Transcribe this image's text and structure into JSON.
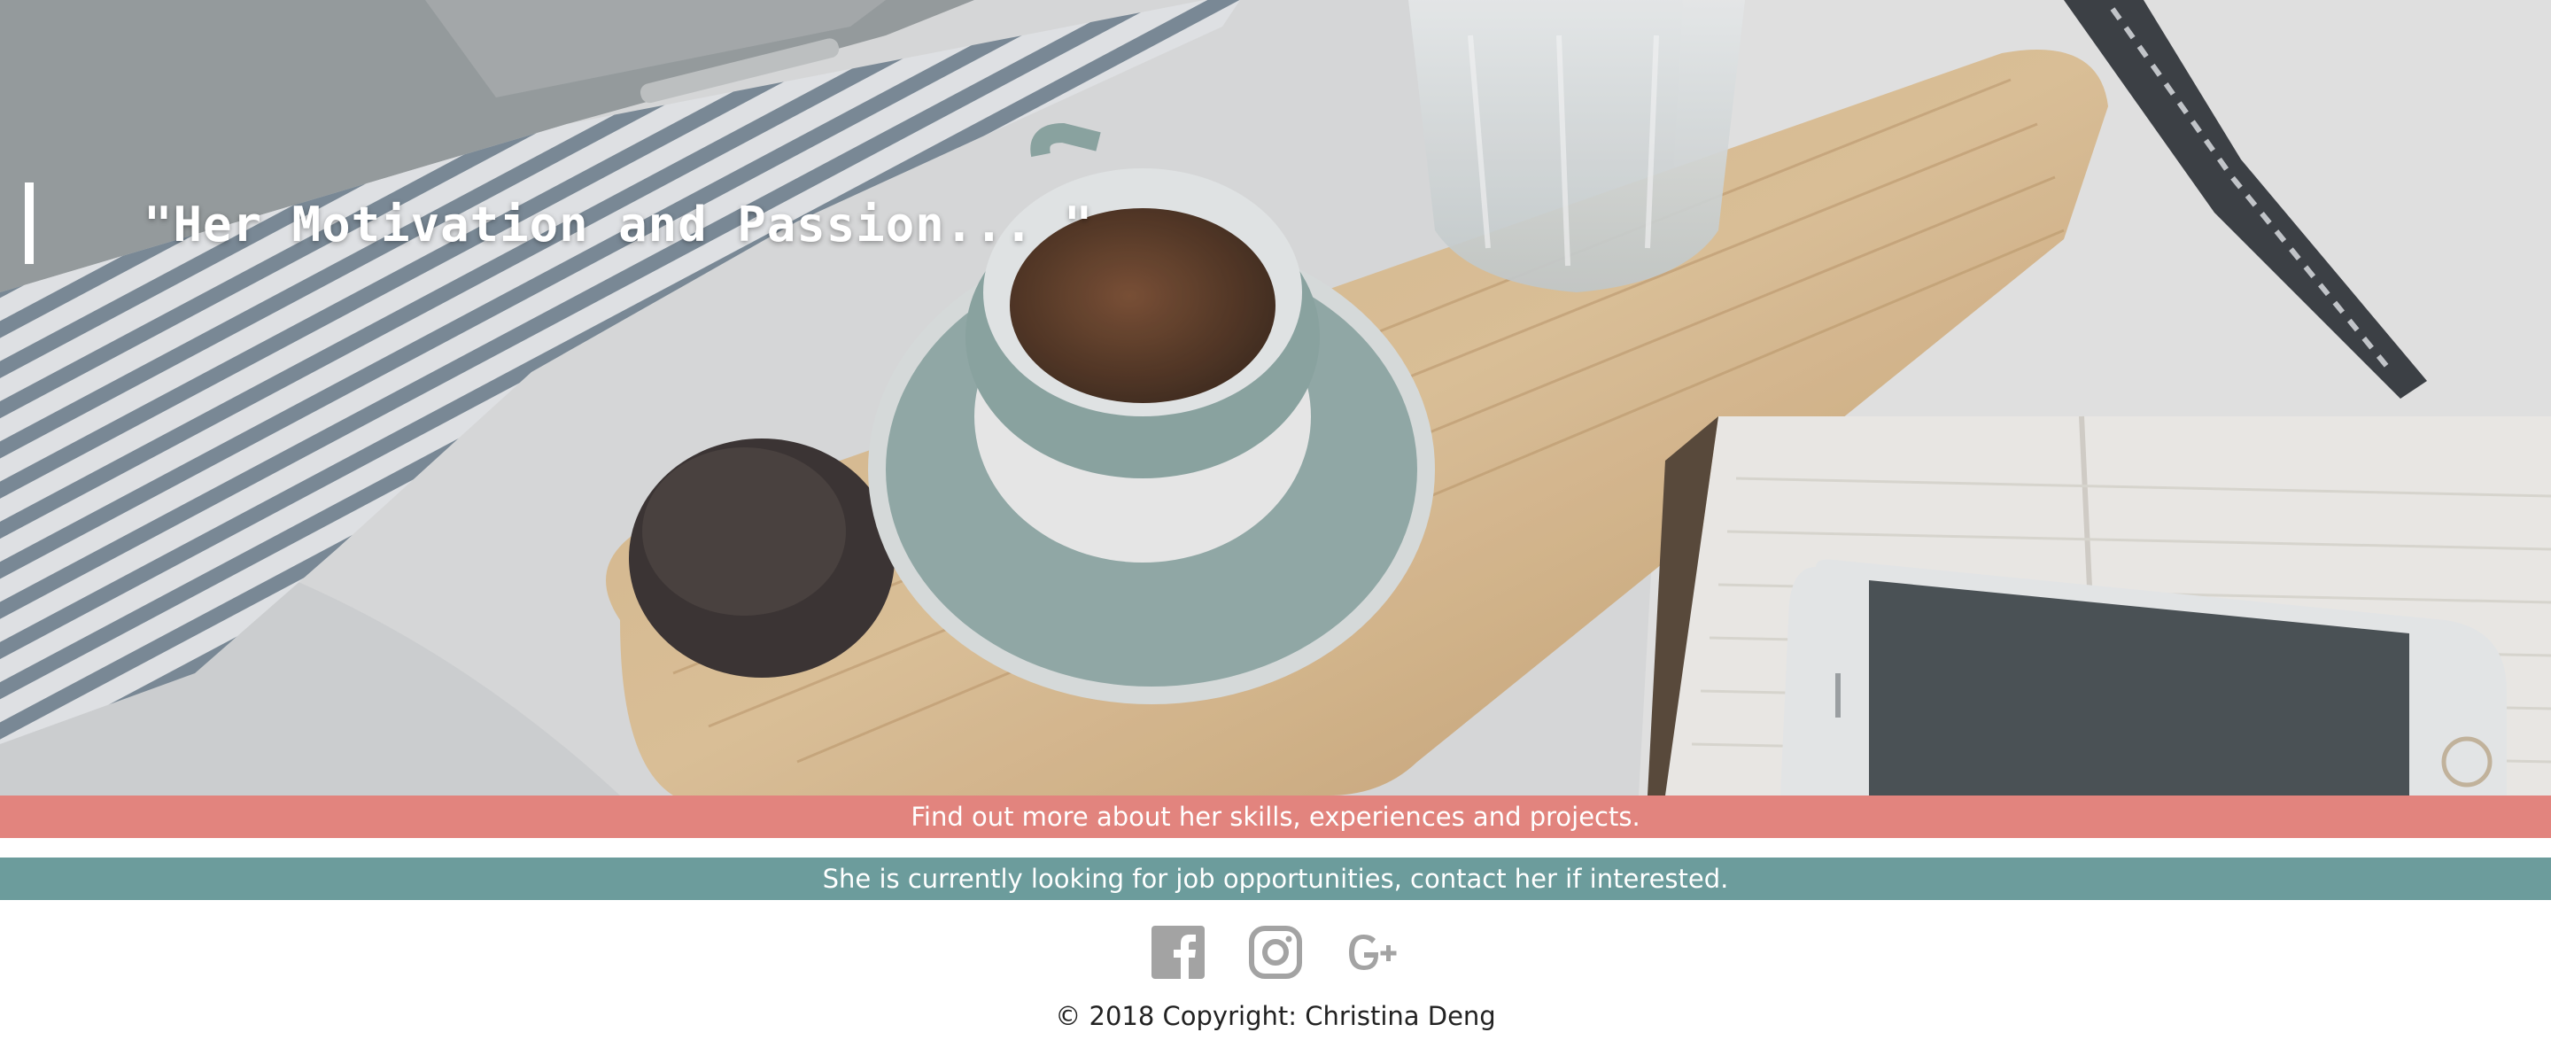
{
  "hero": {
    "quote": "\"Her Motivation and Passion... \"",
    "image_description_icon": "desk-photo-coffee-notebook-phone"
  },
  "banners": {
    "skills_text": "Find out more about her skills, experiences and projects.",
    "jobs_text": "She is currently looking for job opportunities, contact her if interested."
  },
  "social": {
    "items": [
      {
        "name": "facebook-icon"
      },
      {
        "name": "instagram-icon"
      },
      {
        "name": "google-plus-icon"
      }
    ]
  },
  "footer": {
    "copyright": "© 2018 Copyright: Christina Deng"
  },
  "colors": {
    "skills_banner": "#e2847e",
    "jobs_banner": "#6c9c9c",
    "icon_gray": "#a3a3a3",
    "text_dark": "#222222"
  }
}
